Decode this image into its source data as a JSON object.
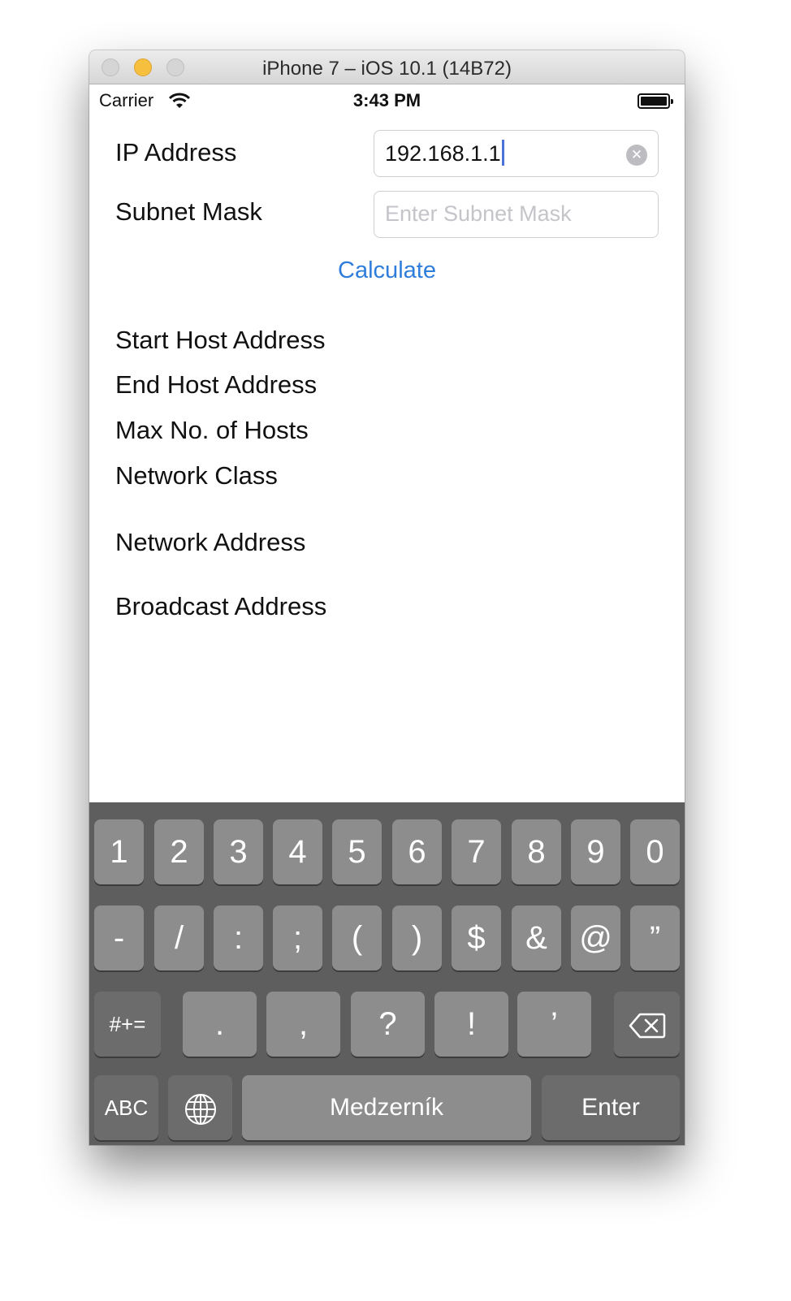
{
  "window": {
    "title": "iPhone 7 – iOS 10.1 (14B72)"
  },
  "status_bar": {
    "carrier": "Carrier",
    "time": "3:43 PM"
  },
  "form": {
    "ip_label": "IP Address",
    "ip_value": "192.168.1.1",
    "subnet_label": "Subnet Mask",
    "subnet_placeholder": "Enter Subnet Mask",
    "subnet_value": "",
    "calculate_label": "Calculate"
  },
  "results": {
    "start_host": "Start Host Address",
    "end_host": "End Host Address",
    "max_hosts": "Max No. of Hosts",
    "network_class": "Network Class",
    "network_address": "Network Address",
    "broadcast_address": "Broadcast Address"
  },
  "keyboard": {
    "row1": [
      "1",
      "2",
      "3",
      "4",
      "5",
      "6",
      "7",
      "8",
      "9",
      "0"
    ],
    "row2": [
      "-",
      "/",
      ":",
      ";",
      "(",
      ")",
      "$",
      "&",
      "@",
      "”"
    ],
    "row3_left": "#+=",
    "row3": [
      ".",
      ",",
      "?",
      "!",
      "’"
    ],
    "backspace_icon": "delete-backward-icon",
    "abc": "ABC",
    "globe_icon": "globe-icon",
    "space": "Medzerník",
    "enter": "Enter"
  }
}
